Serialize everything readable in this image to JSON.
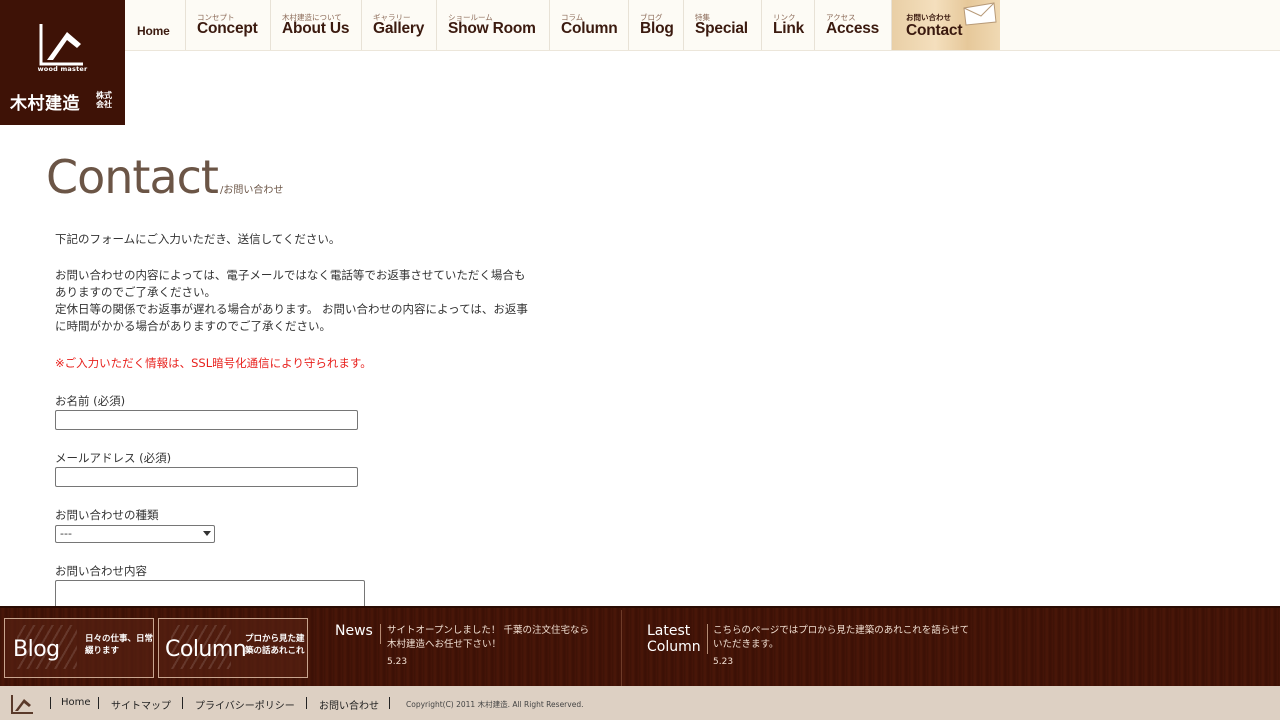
{
  "logo": {
    "brand_en": "wood master",
    "company": "木村建造",
    "suffix": "株式会社"
  },
  "nav": {
    "home": "Home",
    "items": [
      {
        "sub": "コンセプト",
        "label": "Concept"
      },
      {
        "sub": "木村建造について",
        "label": "About Us"
      },
      {
        "sub": "ギャラリー",
        "label": "Gallery"
      },
      {
        "sub": "ショールーム",
        "label": "Show Room"
      },
      {
        "sub": "コラム",
        "label": "Column"
      },
      {
        "sub": "ブログ",
        "label": "Blog"
      },
      {
        "sub": "特集",
        "label": "Special"
      },
      {
        "sub": "リンク",
        "label": "Link"
      },
      {
        "sub": "アクセス",
        "label": "Access"
      }
    ],
    "contact": {
      "sub": "お問い合わせ",
      "label": "Contact"
    }
  },
  "heading": {
    "title": "Contact",
    "subtitle": "/お問い合わせ"
  },
  "intro": "下記のフォームにご入力いただき、送信してください。",
  "notice_line1": "お問い合わせの内容によっては、電子メールではなく電話等でお返事させていただく場合も",
  "notice_line2": "ありますのでご了承ください。",
  "notice_line3": "定休日等の関係でお返事が遅れる場合があります。 お問い合わせの内容によっては、お返事",
  "notice_line4": "に時間がかかる場合がありますのでご了承ください。",
  "ssl_note": "※ご入力いただく情報は、SSL暗号化通信により守られます。",
  "form": {
    "name_label": "お名前 (必須)",
    "name_value": "",
    "email_label": "メールアドレス (必須)",
    "email_value": "",
    "type_label": "お問い合わせの種類",
    "type_selected": "---",
    "content_label": "お問い合わせ内容",
    "content_value": ""
  },
  "footer": {
    "blog_banner": {
      "title": "Blog",
      "text": "日々の仕事、日常綴ります"
    },
    "column_banner": {
      "title": "Column",
      "text": "プロから見た建築の話あれこれ"
    },
    "news": {
      "heading": "News",
      "text": "サイトオープンしました！ 千葉の注文住宅なら木村建造へお任せ下さい！",
      "date": "5.23"
    },
    "latest_column": {
      "heading_line1": "Latest",
      "heading_line2": "Column",
      "text": "こちらのページではプロから見た建築のあれこれを語らせていただきます。",
      "date": "5.23"
    }
  },
  "bottom": {
    "links": [
      "Home",
      "サイトマップ",
      "プライバシーポリシー",
      "お問い合わせ"
    ],
    "copyright": "Copyright(C) 2011 木村建造. All Right Reserved."
  },
  "colors": {
    "brand_brown": "#3e1206",
    "heading_brown": "#6b5546",
    "notice_red": "#e8211d",
    "contact_tab": "#f0d9b3"
  }
}
